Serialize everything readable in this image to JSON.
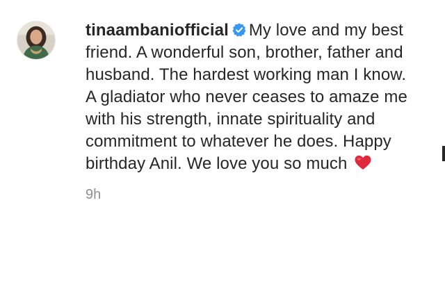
{
  "comment": {
    "username": "tinaambaniofficial",
    "verified_icon": "verified-badge-icon",
    "text": "My love and my best friend. A wonderful son, brother, father and husband. The hardest working man I know. A gladiator who never ceases to amaze me with his strength, innate spirituality and commitment to whatever he does. Happy birthday Anil. We love you so much",
    "emoji_icon": "red-heart-icon",
    "timestamp": "9h"
  },
  "colors": {
    "verified_blue": "#3897f0",
    "heart_red": "#e0293c",
    "meta_gray": "#8e8e8e"
  }
}
